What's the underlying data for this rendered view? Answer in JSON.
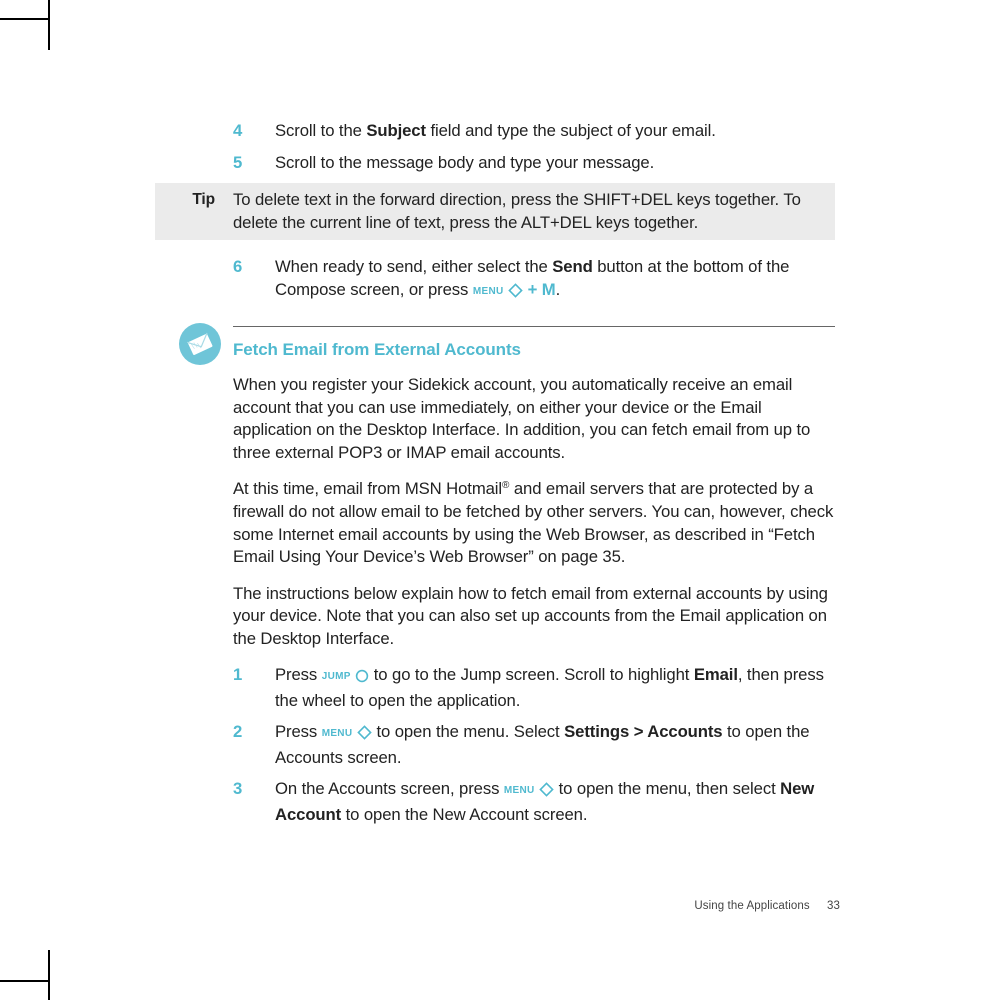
{
  "steps_top": [
    {
      "num": "4",
      "before": "Scroll to the ",
      "bold": "Subject",
      "after": " field and type the subject of your email."
    },
    {
      "num": "5",
      "before": "Scroll to the message body and type your message.",
      "bold": "",
      "after": ""
    }
  ],
  "tip": {
    "label": "Tip",
    "text": "To delete text in the forward direction, press the SHIFT+DEL keys together. To delete the current line of text, press the ALT+DEL keys together."
  },
  "step6": {
    "num": "6",
    "t1": "When ready to send, either select the ",
    "bold": "Send",
    "t2": " button at the bottom of the Compose screen, or press ",
    "menu": "MENU",
    "plus": " + ",
    "m": "M",
    "dot": "."
  },
  "section": {
    "heading": "Fetch Email from External Accounts",
    "p1": "When you register your Sidekick account, you automatically receive an email account that you can use immediately, on either your device or the Email application on the Desktop Interface. In addition, you can fetch email from up to three external POP3 or IMAP email accounts.",
    "p2a": "At this time, email from MSN Hotmail",
    "reg": "®",
    "p2b": " and email servers that are protected by a firewall do not allow email to be fetched by other servers. You can, however, check some Internet email accounts by using the Web Browser, as described in “Fetch Email Using Your Device’s Web Browser” on page 35.",
    "p3": "The instructions below explain how to fetch email from external accounts by using your device. Note that you can also set up accounts from the Email application on the Desktop Interface."
  },
  "steps_bottom": {
    "s1": {
      "num": "1",
      "a": "Press ",
      "jump": "JUMP",
      "b": " to go to the Jump screen. Scroll to highlight ",
      "bold": "Email",
      "c": ", then press the wheel to open the application."
    },
    "s2": {
      "num": "2",
      "a": "Press ",
      "menu": "MENU",
      "b": " to open the menu. Select ",
      "bold": "Settings > Accounts",
      "c": " to open the Accounts screen."
    },
    "s3": {
      "num": "3",
      "a": "On the Accounts screen, press ",
      "menu": "MENU",
      "b": " to open the menu, then select ",
      "bold": "New Account",
      "c": " to open the New Account screen."
    }
  },
  "footer": {
    "section": "Using the Applications",
    "page": "33"
  }
}
